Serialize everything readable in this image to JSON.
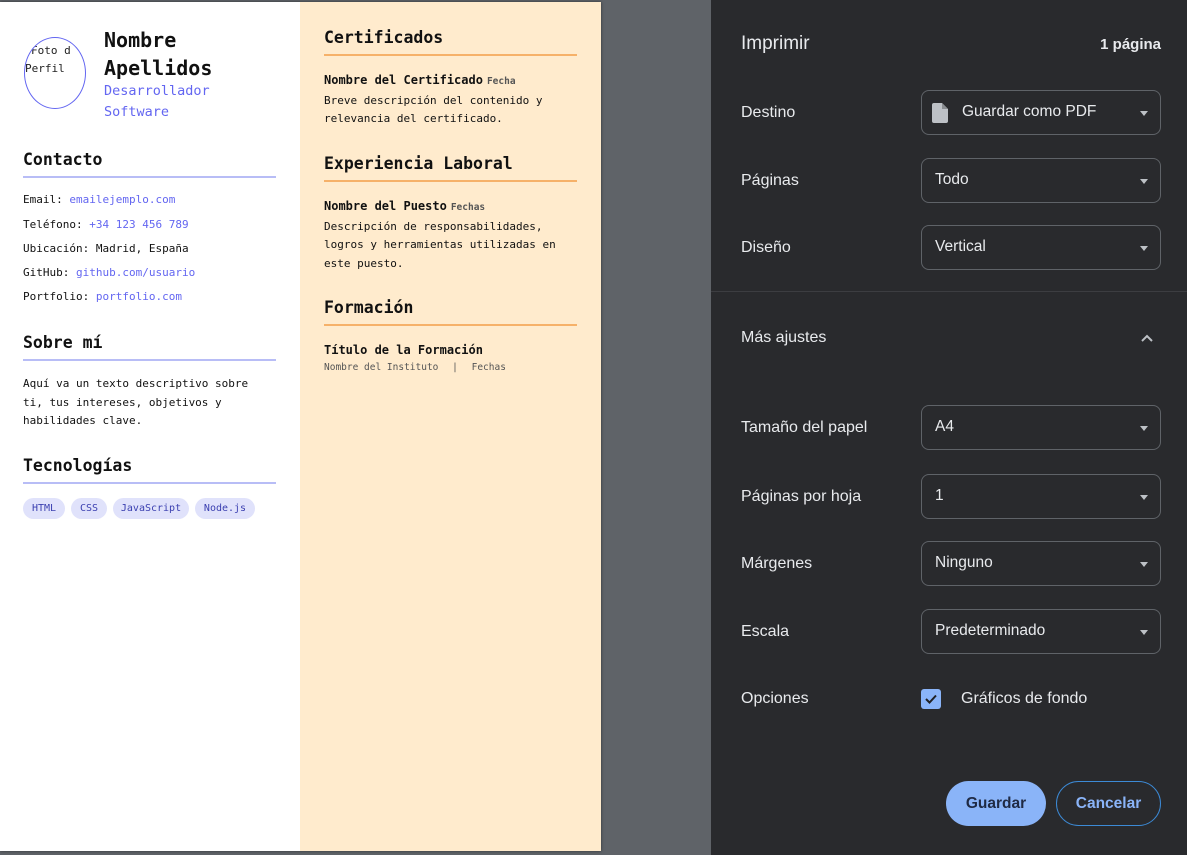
{
  "resume": {
    "photo_alt": "Foto de Perfil",
    "photo_alt_line1": "Foto d",
    "photo_alt_line2": "Perfil",
    "name_line1": "Nombre",
    "name_line2": "Apellidos",
    "role_line1": "Desarrollador",
    "role_line2": "Software",
    "contact": {
      "title": "Contacto",
      "email_label": "Email:",
      "email": "emailejemplo.com",
      "phone_label": "Teléfono:",
      "phone": "+34 123 456 789",
      "location_label": "Ubicación:",
      "location": "Madrid, España",
      "github_label": "GitHub:",
      "github": "github.com/usuario",
      "portfolio_label": "Portfolio:",
      "portfolio": "portfolio.com"
    },
    "about": {
      "title": "Sobre mí",
      "lines": [
        "Aquí va un texto descriptivo sobre",
        "ti, tus intereses, objetivos y",
        "habilidades clave."
      ]
    },
    "tech": {
      "title": "Tecnologías",
      "chips": [
        "HTML",
        "CSS",
        "JavaScript",
        "Node.js"
      ]
    },
    "certificates": {
      "title": "Certificados",
      "item_title": "Nombre del Certificado",
      "item_date": "Fecha",
      "lines": [
        "Breve descripción del contenido y",
        "relevancia del certificado."
      ]
    },
    "experience": {
      "title": "Experiencia Laboral",
      "item_title": "Nombre del Puesto",
      "item_date": "Fechas",
      "lines": [
        "Descripción de responsabilidades,",
        "logros y herramientas utilizadas en",
        "este puesto."
      ]
    },
    "education": {
      "title": "Formación",
      "item_title": "Título de la Formación",
      "institute": "Nombre del Instituto",
      "separator": "|",
      "dates": "Fechas"
    }
  },
  "print_panel": {
    "title": "Imprimir",
    "page_count": "1 página",
    "destination_label": "Destino",
    "destination_value": "Guardar como PDF",
    "pages_label": "Páginas",
    "pages_value": "Todo",
    "layout_label": "Diseño",
    "layout_value": "Vertical",
    "more_settings_label": "Más ajustes",
    "paper_size_label": "Tamaño del papel",
    "paper_size_value": "A4",
    "pages_per_sheet_label": "Páginas por hoja",
    "pages_per_sheet_value": "1",
    "margins_label": "Márgenes",
    "margins_value": "Ninguno",
    "scale_label": "Escala",
    "scale_value": "Predeterminado",
    "options_label": "Opciones",
    "background_graphics_label": "Gráficos de fondo",
    "background_graphics_checked": true,
    "save_button": "Guardar",
    "cancel_button": "Cancelar"
  },
  "colors": {
    "panel_bg": "#292a2d",
    "accent": "#8ab4f8",
    "resume_accent": "#6366f1",
    "right_column_bg": "#ffebcd"
  }
}
